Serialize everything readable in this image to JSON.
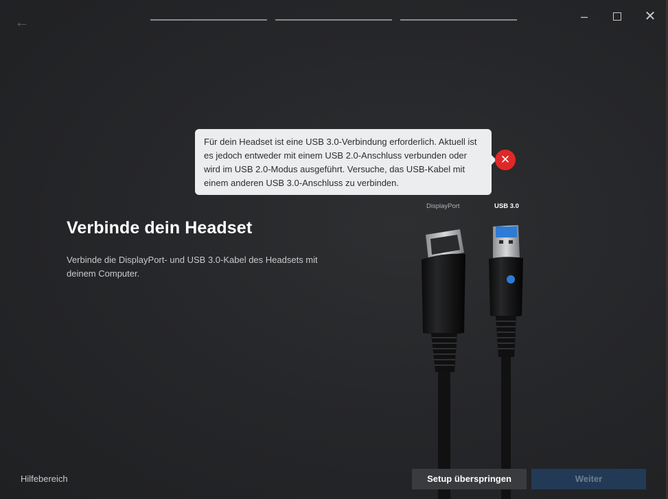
{
  "window": {
    "back_icon": "arrow-left-icon",
    "controls": {
      "minimize": "–",
      "maximize_icon": "maximize-icon",
      "close": "✕"
    },
    "progress_steps": 3
  },
  "tooltip": {
    "text": "Für dein Headset ist eine USB 3.0-Verbindung erforderlich. Aktuell ist es jedoch entweder mit einem USB 2.0-Anschluss verbunden oder wird im USB 2.0-Modus ausgeführt. Versuche, das USB-Kabel mit einem anderen USB 3.0-Anschluss zu verbinden.",
    "status_icon": "error-icon",
    "status_color": "#e02828",
    "close_glyph": "✕"
  },
  "main": {
    "title": "Verbinde dein Headset",
    "description": "Verbinde die DisplayPort- und USB 3.0-Kabel des Headsets mit deinem Computer."
  },
  "cables": {
    "displayport_label": "DisplayPort",
    "usb_label": "USB 3.0",
    "usb_accent": "#2e7bd6"
  },
  "footer": {
    "help": "Hilfebereich",
    "skip": "Setup überspringen",
    "next": "Weiter"
  }
}
